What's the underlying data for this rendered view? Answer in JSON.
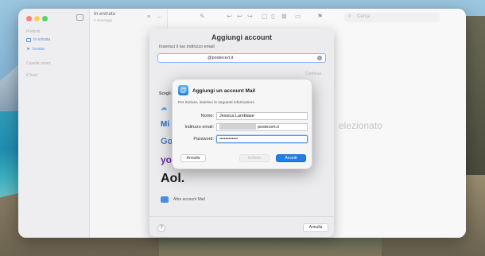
{
  "sidebar": {
    "section_preferiti": "Preferiti",
    "item_in_entrata": "In entrata",
    "item_inviata": "Inviata",
    "section_caselle_smart": "Caselle smart",
    "section_icloud": "iCloud"
  },
  "message_list": {
    "title": "In entrata",
    "subtitle": "0 messaggi"
  },
  "content": {
    "search_placeholder": "Cerca",
    "no_selection_text": "elezionato"
  },
  "add_account_sheet": {
    "title": "Aggiungi account",
    "email_label": "Inserisci il tuo indirizzo email",
    "email_value": "@postecert.it",
    "continue_label": "Continua",
    "choose_label": "Scegli",
    "providers": {
      "icloud": "iCloud",
      "microsoft": "Mi",
      "google": "Go",
      "yahoo": "yo",
      "aol": "Aol."
    },
    "other_account_label": "Altro account Mail",
    "help_label": "?",
    "cancel_label": "Annulla"
  },
  "mail_dialog": {
    "title": "Aggiungi un account Mail",
    "intro": "Per iniziare, inserisci le seguenti informazioni",
    "name_label": "Nome:",
    "name_value": "Jessica Lambiase",
    "email_label": "Indirizzo email:",
    "email_value": "postecert.it",
    "password_label": "Password:",
    "password_value": "••••••••••••",
    "cancel_label": "Annulla",
    "back_label": "Indietro",
    "login_label": "Accedi"
  },
  "colors": {
    "accent": "#1f7fe8",
    "traffic_red": "#fd5d57",
    "traffic_yellow": "#febc2e",
    "traffic_green": "#28c840"
  }
}
